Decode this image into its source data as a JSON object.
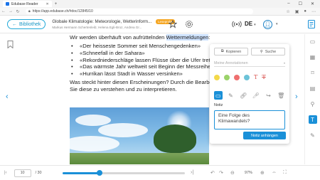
{
  "browser": {
    "tab_title": "Edubase Reader",
    "url": "https://app.edubase.ch/#doc/12845/10"
  },
  "header": {
    "back_label": "Bibliothek",
    "book_title": "Globale Klimatologie: Meteorologie, Wetterinform...",
    "badge": "Leseprobe",
    "authors": "Markus Hermann Schertenleib; Helena Egli-Broz, Andrea Gr...",
    "language": "DE"
  },
  "content": {
    "lead_before": "Wir werden überhäuft von aufrüttelnden ",
    "lead_highlight": "Wettermeldungen",
    "lead_after": ":",
    "bullets": [
      "«Der heisseste Sommer seit Menschengedenken»",
      "«Schneefall in der Sahara»",
      "«Rekordniederschläge lassen Flüsse über die Ufer treten»",
      "«Das wärmste Jahr weltweit seit Beginn der Messreihen»",
      "«Hurrikan lässt Stadt in Wasser versinken»"
    ],
    "question_line1": "Was steckt hinter diesen Erscheinungen? Durch die Bearbeitung",
    "question_line2": "Sie diese zu verstehen und zu interpretieren."
  },
  "popup": {
    "copy_label": "Kopieren",
    "search_label": "Suche",
    "annotations_placeholder": "Meine Annotationen",
    "colors": [
      "#f3d94a",
      "#9bd36a",
      "#ef6f6f",
      "#6cc3d8"
    ],
    "notiz_label": "Notiz",
    "note_text": "Eine Folge des Klimawandels?",
    "attach_label": "Notiz anhängen"
  },
  "footer": {
    "page": "10",
    "total": "/ 30",
    "progress": 0.3,
    "zoom": "97%"
  }
}
